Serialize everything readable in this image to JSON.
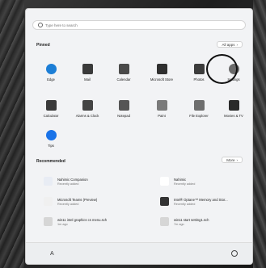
{
  "search": {
    "placeholder": "Type here to search"
  },
  "pinned": {
    "title": "Pinned",
    "all_apps_label": "All apps",
    "all_apps_chevron": "›",
    "apps": [
      {
        "label": "Edge",
        "icon": "edge-icon",
        "color": "#1c7ed6"
      },
      {
        "label": "Mail",
        "icon": "mail-icon",
        "color": "#3a3a3a"
      },
      {
        "label": "Calendar",
        "icon": "calendar-icon",
        "color": "#4a4a4a"
      },
      {
        "label": "Microsoft Store",
        "icon": "store-icon",
        "color": "#2f2f2f"
      },
      {
        "label": "Photos",
        "icon": "photos-icon",
        "color": "#3c3c3c"
      },
      {
        "label": "Settings",
        "icon": "gear-icon",
        "color": "#6a6a6a"
      },
      {
        "label": "Calculator",
        "icon": "calculator-icon",
        "color": "#3a3a3a"
      },
      {
        "label": "Alarms & Clock",
        "icon": "clock-icon",
        "color": "#444444"
      },
      {
        "label": "Notepad",
        "icon": "notepad-icon",
        "color": "#555555"
      },
      {
        "label": "Paint",
        "icon": "paint-icon",
        "color": "#7a7a7a"
      },
      {
        "label": "File Explorer",
        "icon": "folder-icon",
        "color": "#6e6e6e"
      },
      {
        "label": "Movies & TV",
        "icon": "movies-icon",
        "color": "#2a2a2a"
      },
      {
        "label": "Tips",
        "icon": "tips-icon",
        "color": "#1a73e8"
      }
    ]
  },
  "recommended": {
    "title": "Recommended",
    "more_label": "More",
    "more_chevron": "›",
    "items": [
      {
        "title": "Nahimic Companion",
        "sub": "Recently added",
        "icon": "nahimic-companion-icon",
        "color": "#e8ecf4"
      },
      {
        "title": "Nahimic",
        "sub": "Recently added",
        "icon": "nahimic-icon",
        "color": "#ffffff"
      },
      {
        "title": "Microsoft Teams (Preview)",
        "sub": "Recently added",
        "icon": "teams-icon",
        "color": "#f0f0f0"
      },
      {
        "title": "Intel® Optane™ Memory and Stor...",
        "sub": "Recently added",
        "icon": "intel-icon",
        "color": "#333333"
      },
      {
        "title": "win11 intel graphics cs menu.sch",
        "sub": "1m ago",
        "icon": "file-icon",
        "color": "#d6d6d6"
      },
      {
        "title": "win11 start setting1.sch",
        "sub": "7m ago",
        "icon": "file-icon",
        "color": "#d6d6d6"
      }
    ]
  },
  "footer": {
    "user_glyph": "A",
    "power_glyph": "⏻"
  }
}
